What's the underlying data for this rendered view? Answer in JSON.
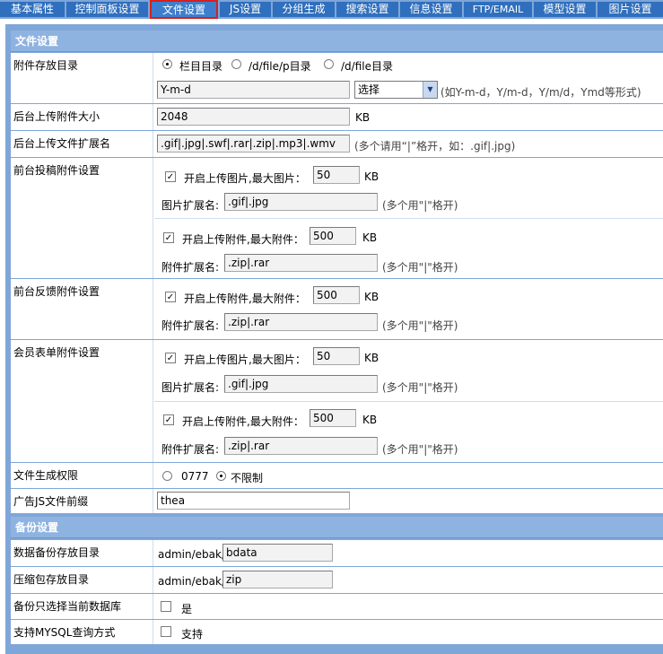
{
  "tabs": [
    {
      "label": "基本属性"
    },
    {
      "label": "控制面板设置"
    },
    {
      "label": "文件设置"
    },
    {
      "label": "JS设置"
    },
    {
      "label": "分组生成"
    },
    {
      "label": "搜索设置"
    },
    {
      "label": "信息设置"
    },
    {
      "label": "FTP/EMAIL"
    },
    {
      "label": "模型设置"
    },
    {
      "label": "图片设置"
    }
  ],
  "file_section": {
    "title": "文件设置",
    "attach_dir": {
      "label": "附件存放目录",
      "options": [
        "栏目目录",
        "/d/file/p目录",
        "/d/file目录"
      ],
      "selected": "栏目目录",
      "date_format_value": "Y-m-d",
      "format_select_value": "选择",
      "hint": "(如Y-m-d，Y/m-d，Y/m/d，Ymd等形式)"
    },
    "max_upload": {
      "label": "后台上传附件大小",
      "value": "2048",
      "unit": "KB"
    },
    "extensions": {
      "label": "后台上传文件扩展名",
      "value": ".gif|.jpg|.swf|.rar|.zip|.mp3|.wmv",
      "hint": "(多个请用“|”格开，如：.gif|.jpg)"
    },
    "front_submit": {
      "label": "前台投稿附件设置",
      "img_check_label": "开启上传图片,最大图片：",
      "img_size": "50",
      "img_unit": "KB",
      "img_ext_label": "图片扩展名:",
      "img_ext": ".gif|.jpg",
      "img_hint": "(多个用\"|\"格开)",
      "file_check_label": "开启上传附件,最大附件：",
      "file_size": "500",
      "file_unit": "KB",
      "file_ext_label": "附件扩展名:",
      "file_ext": ".zip|.rar",
      "file_hint": "(多个用\"|\"格开)"
    },
    "front_feedback": {
      "label": "前台反馈附件设置",
      "file_check_label": "开启上传附件,最大附件：",
      "file_size": "500",
      "file_unit": "KB",
      "file_ext_label": "附件扩展名:",
      "file_ext": ".zip|.rar",
      "file_hint": "(多个用\"|\"格开)"
    },
    "member_form": {
      "label": "会员表单附件设置",
      "img_check_label": "开启上传图片,最大图片：",
      "img_size": "50",
      "img_unit": "KB",
      "img_ext_label": "图片扩展名:",
      "img_ext": ".gif|.jpg",
      "img_hint": "(多个用\"|\"格开)",
      "file_check_label": "开启上传附件,最大附件：",
      "file_size": "500",
      "file_unit": "KB",
      "file_ext_label": "附件扩展名:",
      "file_ext": ".zip|.rar",
      "file_hint": "(多个用\"|\"格开)"
    },
    "file_perm": {
      "label": "文件生成权限",
      "options": [
        "0777",
        "不限制"
      ],
      "selected": "不限制"
    },
    "ad_js_prefix": {
      "label": "广告JS文件前缀",
      "value": "thea"
    }
  },
  "backup_section": {
    "title": "备份设置",
    "backup_dir": {
      "label": "数据备份存放目录",
      "prefix": "admin/ebak/",
      "value": "bdata"
    },
    "zip_dir": {
      "label": "压缩包存放目录",
      "prefix": "admin/ebak/",
      "value": "zip"
    },
    "current_db": {
      "label": "备份只选择当前数据库",
      "check_label": "是",
      "checked": false
    },
    "mysql_query": {
      "label": "支持MYSQL查询方式",
      "check_label": "支持",
      "checked": false
    }
  }
}
